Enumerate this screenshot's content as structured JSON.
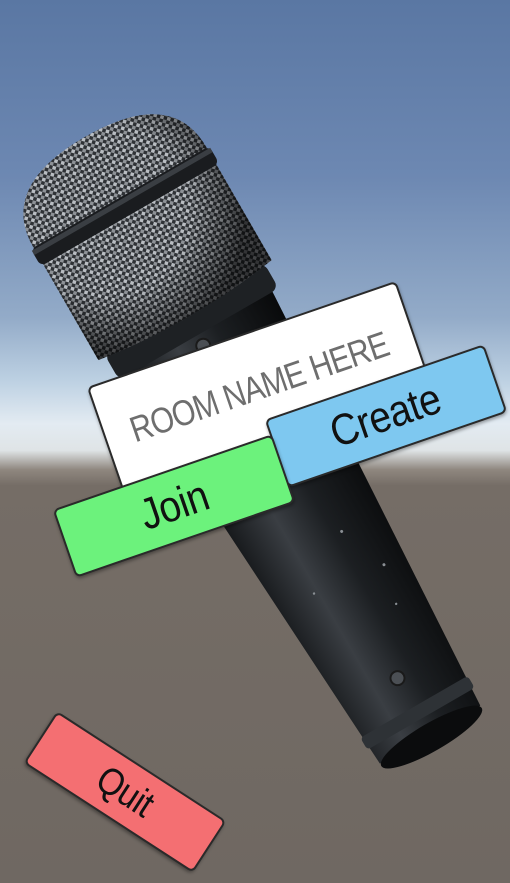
{
  "room_input": {
    "placeholder": "ROOM NAME HERE"
  },
  "buttons": {
    "create": "Create",
    "join": "Join",
    "quit": "Quit"
  },
  "colors": {
    "create_button": "#7ec8f0",
    "join_button": "#6cf27c",
    "quit_button": "#f46f72",
    "input_background": "#ffffff",
    "sky_top": "#5a77a3",
    "ground": "#6f6862"
  },
  "scene_object": "microphone"
}
